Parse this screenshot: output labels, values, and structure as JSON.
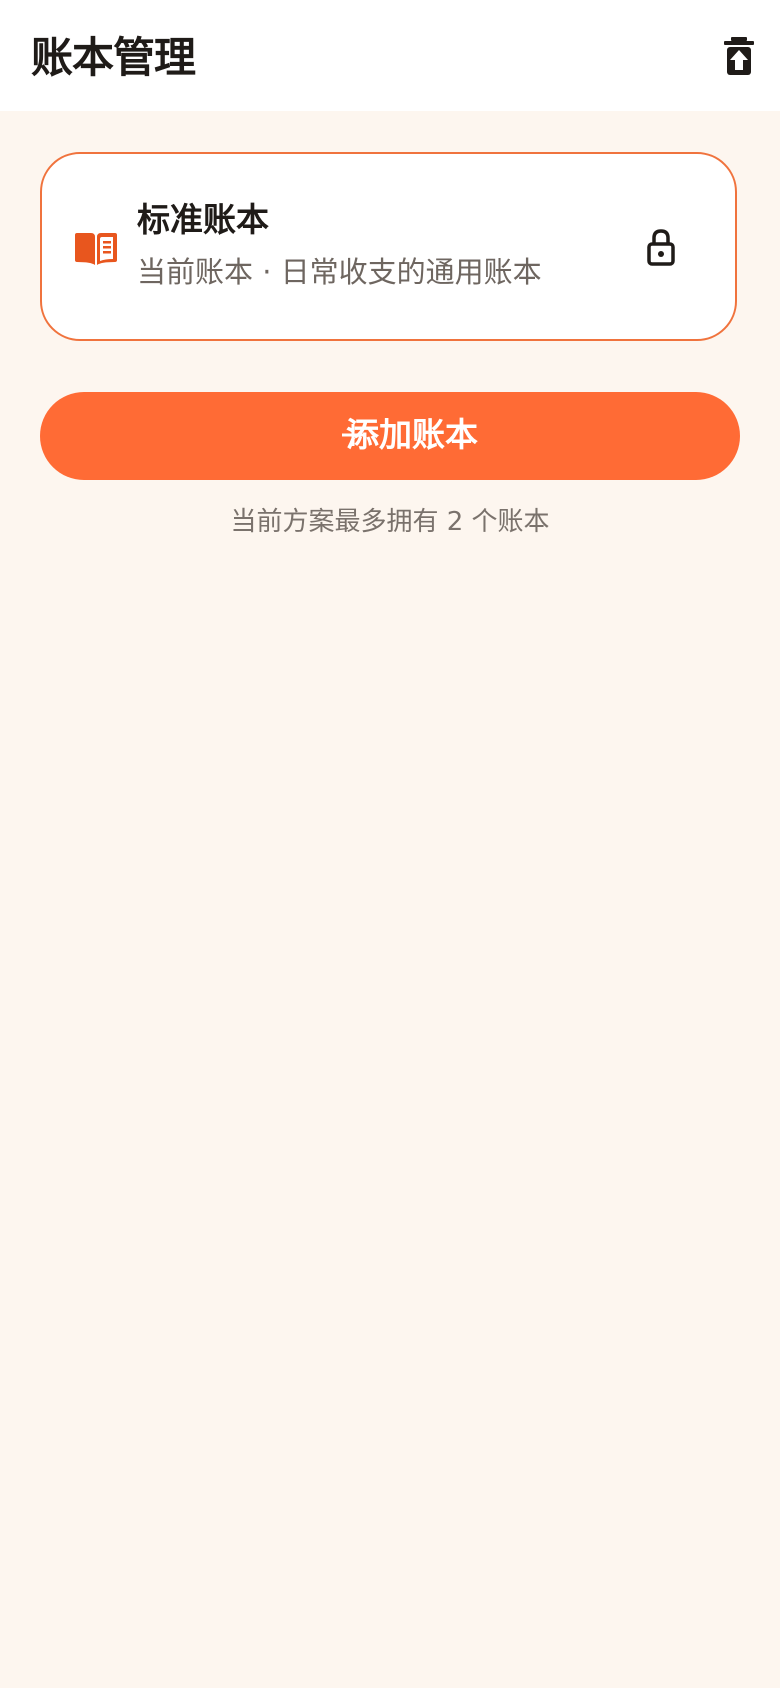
{
  "header": {
    "title": "账本管理",
    "action_icon": "trash-restore-icon"
  },
  "current_book": {
    "icon": "open-book-icon",
    "name": "标准账本",
    "description": "当前账本 · 日常收支的通用账本",
    "status_icon": "lock-icon"
  },
  "add_button": {
    "icon": "plus-icon",
    "label": "添加账本"
  },
  "plan_note": "当前方案最多拥有 2 个账本",
  "colors": {
    "accent": "#FF6B35",
    "card_border": "#F0733D",
    "book_icon": "#E8561E",
    "background": "#FDF6EF",
    "title_text": "#1F1B18",
    "secondary_text": "#6E6660"
  }
}
